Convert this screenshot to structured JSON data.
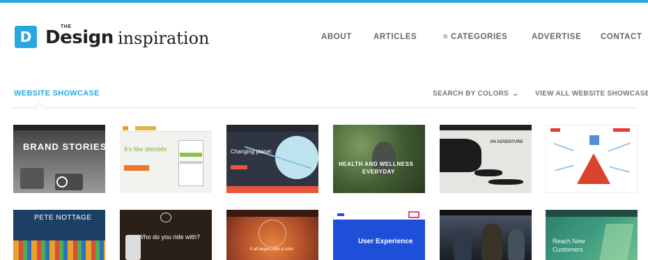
{
  "header": {
    "logo_letter": "D",
    "logo_the": "THE",
    "logo_design": "Design",
    "logo_inspiration": "inspiration",
    "accent_color": "#29a8df"
  },
  "nav": {
    "about": "ABOUT",
    "articles": "ARTICLES",
    "categories": "≡ CATEGORIES",
    "advertise": "ADVERTISE",
    "contact": "CONTACT"
  },
  "showcase": {
    "title": "WEBSITE SHOWCASE",
    "search_colors": "SEARCH BY COLORS",
    "search_colors_icon": "chevron-down-icon",
    "view_all": "VIEW ALL WEBSITE SHOWCASE"
  },
  "thumbnails": [
    {
      "text": "BRAND STORIES"
    },
    {
      "text": "It's like steroids"
    },
    {
      "text": "Changing planet"
    },
    {
      "text": "HEALTH AND WELLNESS",
      "text2": "EVERYDAY"
    },
    {
      "text": "AN ADVENTURE"
    },
    {
      "text": ""
    },
    {
      "text": "PETE NOTTAGE"
    },
    {
      "text": "Who do you ride with?"
    },
    {
      "text": "It all begins with a color"
    },
    {
      "text": "User Experience"
    },
    {
      "text": ""
    },
    {
      "text": "Reach New",
      "text2": "Customers"
    }
  ]
}
